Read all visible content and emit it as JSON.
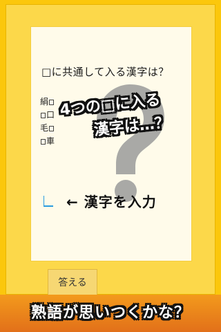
{
  "question": "□に共通して入る漢字は？",
  "clues": [
    {
      "before": "絹",
      "after": ""
    },
    {
      "before": "",
      "after": "口"
    },
    {
      "before": "毛",
      "after": ""
    },
    {
      "before": "",
      "after": "車"
    }
  ],
  "hint": {
    "line1": "4つの□に入る",
    "line2": "漢字は…？"
  },
  "input_hint": "← 漢字を入力",
  "answer_button": "答える",
  "banner": "熟語が思いつくかな？",
  "colors": {
    "background": "#fbc70c",
    "card": "#fffbea",
    "banner": "#e2701a",
    "button": "#f6d773",
    "cursor": "#2a9be0"
  },
  "icons": {
    "big_question": "question-mark-icon"
  }
}
